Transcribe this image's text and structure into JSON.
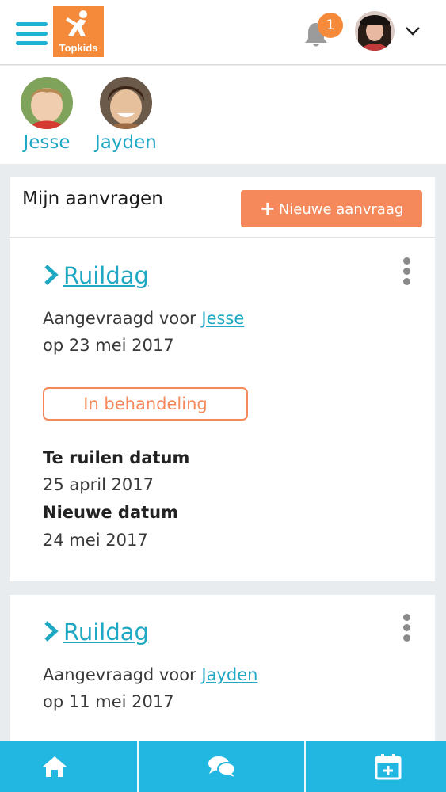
{
  "header": {
    "logo_text": "Topkids",
    "notification_count": "1",
    "menu_icon": "hamburger-icon",
    "bell_icon": "bell-icon",
    "chevron_icon": "chevron-down-icon"
  },
  "children": [
    {
      "name": "Jesse"
    },
    {
      "name": "Jayden"
    }
  ],
  "panel": {
    "title": "Mijn aanvragen",
    "new_button_label": "Nieuwe aanvraag"
  },
  "requests": [
    {
      "title": "Ruildag",
      "requested_for_prefix": "Aangevraagd voor",
      "child": "Jesse",
      "date_line": "op 23 mei 2017",
      "status": "In behandeling",
      "swap_label": "Te ruilen datum",
      "swap_date": "25 april 2017",
      "new_label": "Nieuwe datum",
      "new_date": "24 mei 2017"
    },
    {
      "title": "Ruildag",
      "requested_for_prefix": "Aangevraagd voor",
      "child": "Jayden",
      "date_line": "op 11 mei 2017"
    }
  ],
  "bottom_nav": [
    {
      "icon": "home-icon"
    },
    {
      "icon": "chat-icon"
    },
    {
      "icon": "calendar-add-icon"
    }
  ],
  "colors": {
    "accent_blue": "#1fa8c3",
    "accent_orange": "#f5895b",
    "nav_blue": "#21b7e0"
  }
}
